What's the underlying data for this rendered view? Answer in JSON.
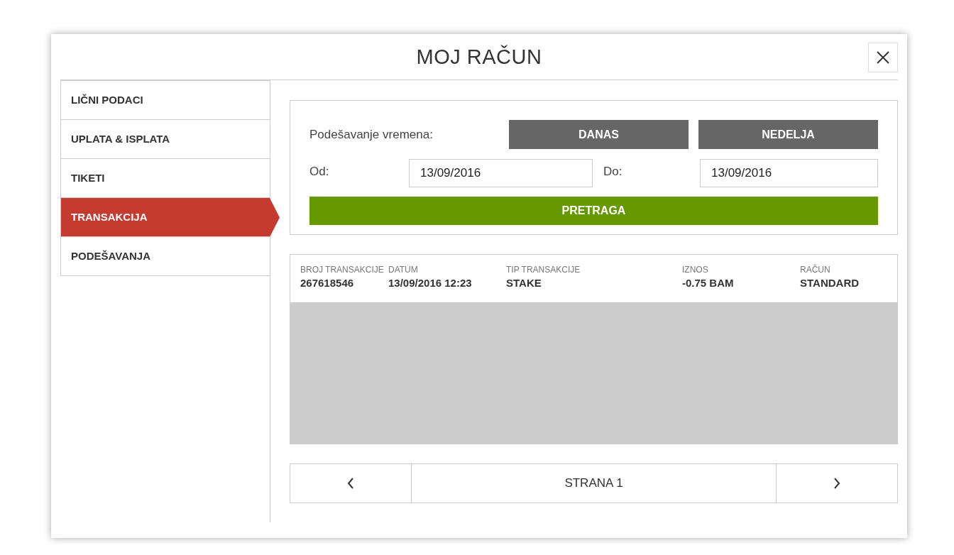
{
  "dialog": {
    "title": "MOJ RAČUN"
  },
  "sidebar": {
    "items": [
      {
        "label": "LIČNI PODACI",
        "selected": false
      },
      {
        "label": "UPLATA & ISPLATA",
        "selected": false
      },
      {
        "label": "TIKETI",
        "selected": false
      },
      {
        "label": "TRANSAKCIJA",
        "selected": true
      },
      {
        "label": "PODEŠAVANJA",
        "selected": false
      }
    ]
  },
  "filter": {
    "time_label": "Podešavanje vremena:",
    "presets": [
      "DANAS",
      "NEDELJA"
    ],
    "from_label": "Od:",
    "from_value": "13/09/2016",
    "to_label": "Do:",
    "to_value": "13/09/2016",
    "search_button": "PRETRAGA"
  },
  "table": {
    "columns": [
      "BROJ TRANSAKCIJE",
      "DATUM",
      "TIP TRANSAKCIJE",
      "IZNOS",
      "RAČUN"
    ],
    "rows": [
      [
        "267618546",
        "13/09/2016 12:23",
        "STAKE",
        "-0.75 BAM",
        "STANDARD"
      ]
    ]
  },
  "pager": {
    "page_label": "STRANA 1"
  }
}
